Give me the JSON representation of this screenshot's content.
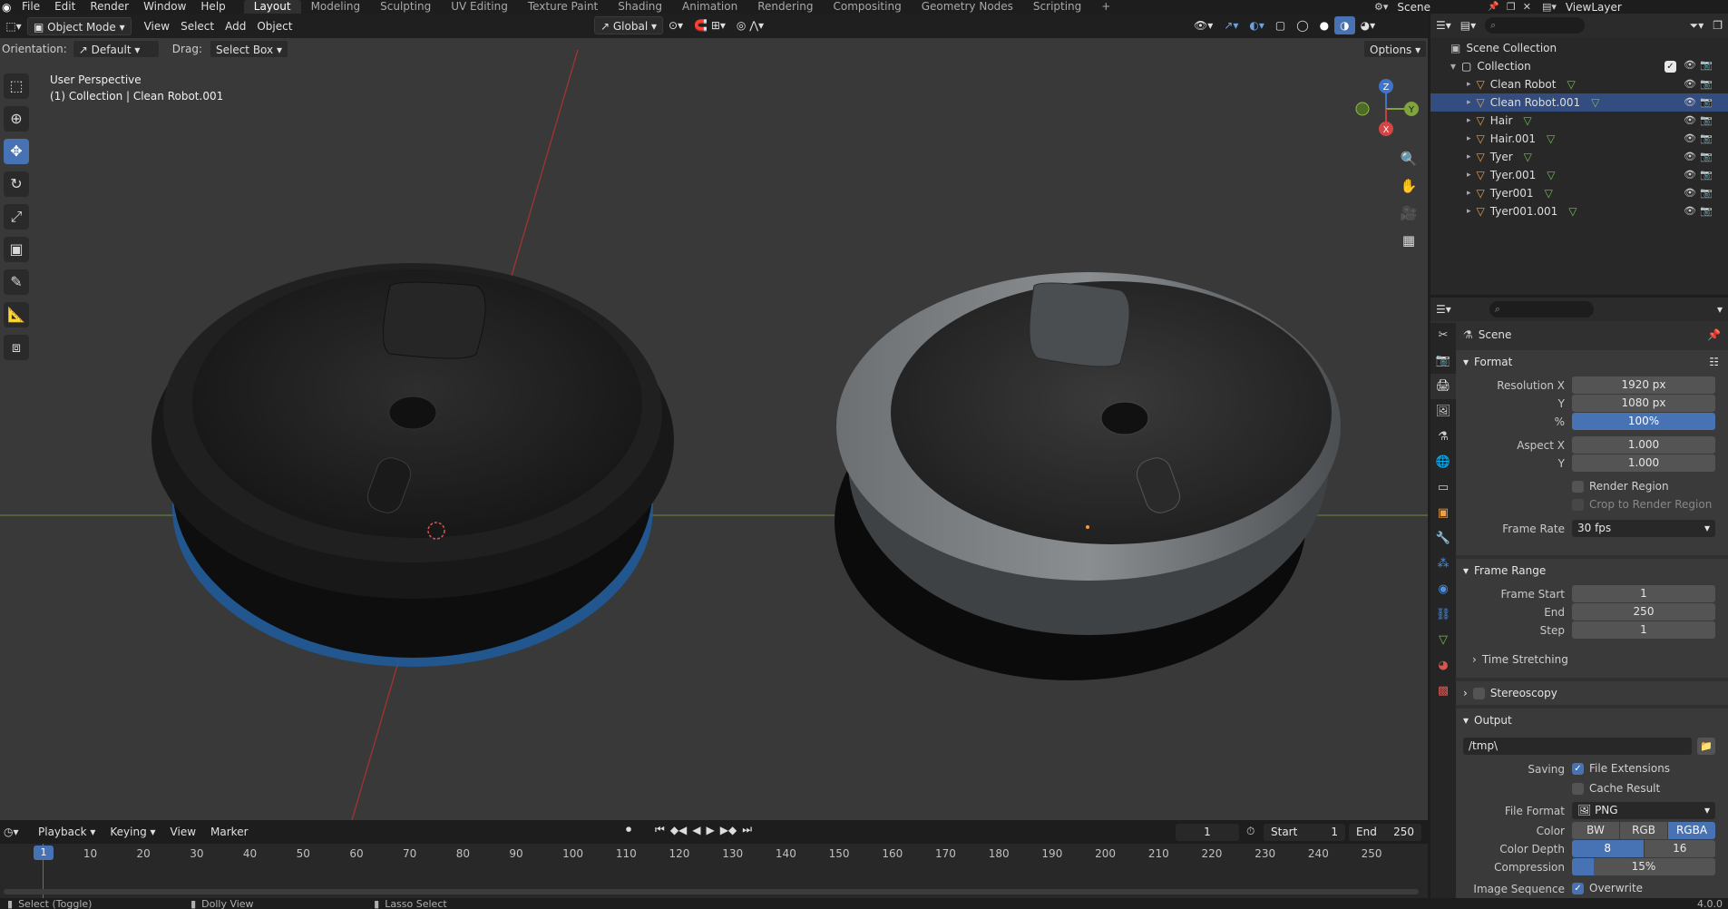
{
  "topbar": {
    "menus": [
      "File",
      "Edit",
      "Render",
      "Window",
      "Help"
    ],
    "workspaces": [
      "Layout",
      "Modeling",
      "Sculpting",
      "UV Editing",
      "Texture Paint",
      "Shading",
      "Animation",
      "Rendering",
      "Compositing",
      "Geometry Nodes",
      "Scripting"
    ],
    "active_workspace": "Layout",
    "add_tab": "+",
    "scene": "Scene",
    "view_layer": "ViewLayer"
  },
  "viewport": {
    "mode": "Object Mode",
    "menus": [
      "View",
      "Select",
      "Add",
      "Object"
    ],
    "transform_orientation": "Global",
    "orientation_label": "Orientation:",
    "orientation_value": "Default",
    "drag_label": "Drag:",
    "drag_value": "Select Box",
    "options": "Options",
    "info_line1": "User Perspective",
    "info_line2": "(1) Collection | Clean Robot.001",
    "gizmo": {
      "x": "X",
      "y": "Y",
      "z": "Z"
    }
  },
  "outliner": {
    "scene_collection": "Scene Collection",
    "collection": "Collection",
    "items": [
      "Clean Robot",
      "Clean Robot.001",
      "Hair",
      "Hair.001",
      "Tyer",
      "Tyer.001",
      "Tyer001",
      "Tyer001.001"
    ]
  },
  "properties": {
    "header": "Scene",
    "format": {
      "title": "Format",
      "res_x_label": "Resolution X",
      "res_x": "1920 px",
      "res_y_label": "Y",
      "res_y": "1080 px",
      "pct_label": "%",
      "pct": "100%",
      "aspect_x_label": "Aspect X",
      "aspect_x": "1.000",
      "aspect_y_label": "Y",
      "aspect_y": "1.000",
      "render_region": "Render Region",
      "crop": "Crop to Render Region",
      "frame_rate_label": "Frame Rate",
      "frame_rate": "30 fps"
    },
    "frame_range": {
      "title": "Frame Range",
      "start_label": "Frame Start",
      "start": "1",
      "end_label": "End",
      "end": "250",
      "step_label": "Step",
      "step": "1",
      "time_stretching": "Time Stretching"
    },
    "stereoscopy": "Stereoscopy",
    "output": {
      "title": "Output",
      "path": "/tmp\\",
      "saving_label": "Saving",
      "file_ext": "File Extensions",
      "cache": "Cache Result",
      "file_format_label": "File Format",
      "file_format": "PNG",
      "color_label": "Color",
      "color_opts": [
        "BW",
        "RGB",
        "RGBA"
      ],
      "color_active": "RGBA",
      "depth_label": "Color Depth",
      "depth_opts": [
        "8",
        "16"
      ],
      "depth_active": "8",
      "compression_label": "Compression",
      "compression": "15%",
      "compression_level": 0.15,
      "image_seq_label": "Image Sequence",
      "overwrite": "Overwrite"
    }
  },
  "timeline": {
    "menus": [
      "Playback",
      "Keying",
      "View",
      "Marker"
    ],
    "current_frame": "1",
    "start_label": "Start",
    "start": "1",
    "end_label": "End",
    "end": "250",
    "ticks": [
      "10",
      "20",
      "30",
      "40",
      "50",
      "60",
      "70",
      "80",
      "90",
      "100",
      "110",
      "120",
      "130",
      "140",
      "150",
      "160",
      "170",
      "180",
      "190",
      "200",
      "210",
      "220",
      "230",
      "240",
      "250"
    ]
  },
  "statusbar": {
    "select": "Select (Toggle)",
    "dolly": "Dolly View",
    "lasso": "Lasso Select",
    "version": "4.0.0"
  },
  "colors": {
    "accent": "#4772b3",
    "header": "#1d1d1d",
    "viewport_bg": "#393939",
    "panel": "#303030"
  }
}
